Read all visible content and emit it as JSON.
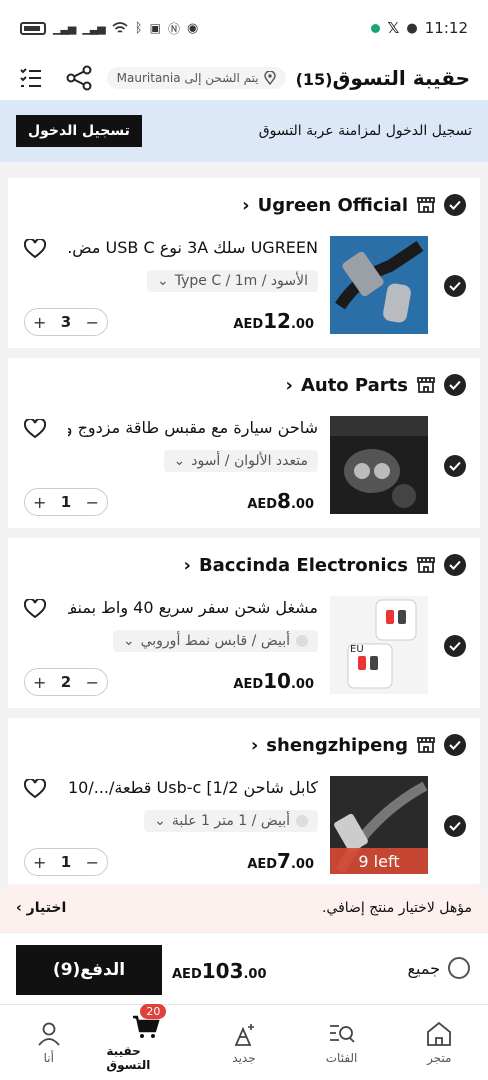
{
  "status_bar": {
    "time": "11:12"
  },
  "header": {
    "title": "حقيبة التسوق",
    "count": "(15)",
    "ship_to": "يتم الشحن إلى Mauritania"
  },
  "login_banner": {
    "text": "تسجيل الدخول لمزامنة عربة التسوق",
    "button": "تسجيل الدخول"
  },
  "items": [
    {
      "store": "Ugreen Official",
      "title": "UGREEN سلك 3A نوع USB C مض...",
      "variant": "الأسود / Type C / 1m",
      "currency": "AED",
      "price_int": "12",
      "price_dec": ".00",
      "qty": "3"
    },
    {
      "store": "Auto Parts",
      "title": "شاحن سيارة مع مقبس طاقة مزدوج و...",
      "variant": "متعدد الألوان / أسود",
      "currency": "AED",
      "price_int": "8",
      "price_dec": ".00",
      "qty": "1"
    },
    {
      "store": "Baccinda Electronics",
      "title": "مشغل شحن سفر سريع 40 واط بمنف...",
      "variant": "أبيض / قابس نمط أوروبي",
      "currency": "AED",
      "price_int": "10",
      "price_dec": ".00",
      "qty": "2",
      "thumb_label": "EU"
    },
    {
      "store": "shengzhipeng",
      "title": "كابل شاحن Usb-c [1/2 قطعة/.../10",
      "variant": "أبيض / 1 متر 1 علبة",
      "currency": "AED",
      "price_int": "7",
      "price_dec": ".00",
      "qty": "1",
      "stock_badge": "9 left"
    }
  ],
  "stepper": {
    "minus": "−",
    "plus": "+"
  },
  "promo": {
    "text": "مؤهل لاختيار منتج إضافي.",
    "link": "اختيار"
  },
  "checkout": {
    "select_all": "جميع",
    "currency": "AED",
    "total_int": "103",
    "total_dec": ".00",
    "pay_button": "الدفع(9)"
  },
  "bottom_nav": {
    "store": "متجر",
    "categories": "الفئات",
    "new": "جديد",
    "bag": "حقيبة التسوق",
    "bag_badge": "20",
    "me": "أنا"
  },
  "colors": {
    "accent": "#111111",
    "banner_bg": "#dce8f7",
    "badge_red": "#e0413a",
    "promo_bg": "#fdf1ef"
  },
  "icons": [
    "battery-icon",
    "signal-icon",
    "wifi-icon",
    "bluetooth-icon",
    "x-app-icon",
    "location-pin-icon",
    "share-icon",
    "list-edit-icon",
    "store-icon",
    "check-icon",
    "chevron-left-icon",
    "wishlist-heart-icon",
    "chevron-down-icon",
    "home-store-icon",
    "search-categories-icon",
    "new-sparkle-icon",
    "cart-icon",
    "person-icon"
  ]
}
